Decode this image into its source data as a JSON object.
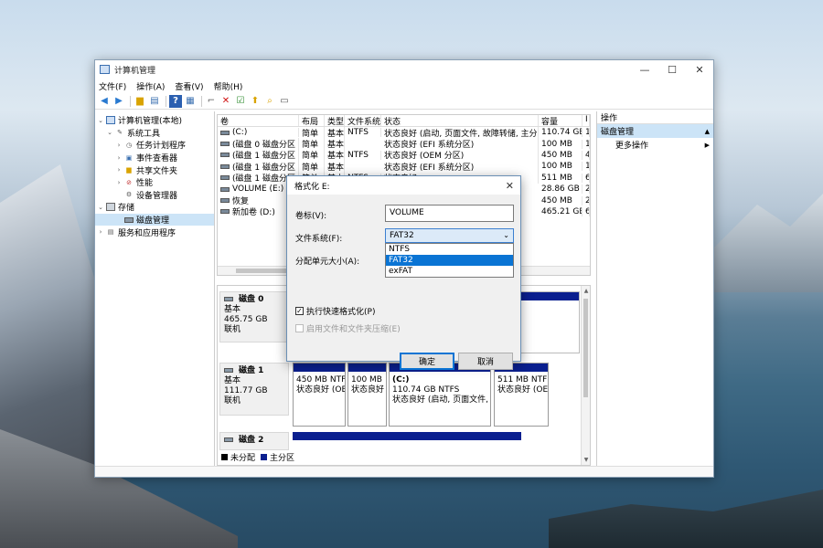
{
  "window": {
    "title": "计算机管理"
  },
  "menu": [
    "文件(F)",
    "操作(A)",
    "查看(V)",
    "帮助(H)"
  ],
  "tree": {
    "root": "计算机管理(本地)",
    "items": [
      {
        "label": "系统工具",
        "level": 1,
        "expanded": true
      },
      {
        "label": "任务计划程序",
        "level": 2
      },
      {
        "label": "事件查看器",
        "level": 2
      },
      {
        "label": "共享文件夹",
        "level": 2
      },
      {
        "label": "性能",
        "level": 2
      },
      {
        "label": "设备管理器",
        "level": 2
      },
      {
        "label": "存储",
        "level": 1,
        "expanded": true
      },
      {
        "label": "磁盘管理",
        "level": 2,
        "selected": true
      },
      {
        "label": "服务和应用程序",
        "level": 1
      }
    ]
  },
  "volume_table": {
    "headers": [
      "卷",
      "布局",
      "类型",
      "文件系统",
      "状态",
      "容量",
      "I"
    ],
    "rows": [
      [
        "(C:)",
        "简单",
        "基本",
        "NTFS",
        "状态良好 (启动, 页面文件, 故障转储, 主分区)",
        "110.74 GB",
        "1"
      ],
      [
        "(磁盘 0 磁盘分区 2)",
        "简单",
        "基本",
        "",
        "状态良好 (EFI 系统分区)",
        "100 MB",
        "1"
      ],
      [
        "(磁盘 1 磁盘分区 1)",
        "简单",
        "基本",
        "NTFS",
        "状态良好 (OEM 分区)",
        "450 MB",
        "4"
      ],
      [
        "(磁盘 1 磁盘分区 2)",
        "简单",
        "基本",
        "",
        "状态良好 (EFI 系统分区)",
        "100 MB",
        "1"
      ],
      [
        "(磁盘 1 磁盘分区",
        "简单",
        "基本",
        "NTFS",
        "状态良好",
        "511 MB",
        "6"
      ],
      [
        "VOLUME (E:)",
        "",
        "",
        "",
        "",
        "28.86 GB",
        "2"
      ],
      [
        "恢复",
        "",
        "",
        "",
        "",
        "450 MB",
        "2"
      ],
      [
        "新加卷 (D:)",
        "",
        "",
        "",
        "",
        "465.21 GB",
        "6"
      ]
    ]
  },
  "disks": [
    {
      "name": "磁盘 0",
      "type": "基本",
      "size": "465.75 GB",
      "status": "联机"
    },
    {
      "name": "磁盘 1",
      "type": "基本",
      "size": "111.77 GB",
      "status": "联机",
      "partitions": [
        {
          "line1": "450 MB NTF",
          "line2": "状态良好 (OE"
        },
        {
          "line1": "100 MB",
          "line2": "状态良好"
        },
        {
          "line0": "(C:)",
          "line1": "110.74 GB NTFS",
          "line2": "状态良好 (启动, 页面文件, 故"
        },
        {
          "line1": "511 MB NTF",
          "line2": "状态良好 (OE"
        }
      ]
    },
    {
      "name": "磁盘 2"
    }
  ],
  "legend": {
    "unallocated": "未分配",
    "primary": "主分区"
  },
  "actions": {
    "header": "操作",
    "section": "磁盘管理",
    "more": "更多操作"
  },
  "dialog": {
    "title": "格式化 E:",
    "volume_label": "卷标(V):",
    "volume_value": "VOLUME",
    "fs_label": "文件系统(F):",
    "fs_value": "FAT32",
    "fs_options": [
      "NTFS",
      "FAT32",
      "exFAT"
    ],
    "alloc_label": "分配单元大小(A):",
    "quick_format": "执行快速格式化(P)",
    "compression": "启用文件和文件夹压缩(E)",
    "ok": "确定",
    "cancel": "取消"
  },
  "colors": {
    "accent": "#0a74d4",
    "partition_bar": "#0a1f8f",
    "selection": "#cce4f7"
  }
}
